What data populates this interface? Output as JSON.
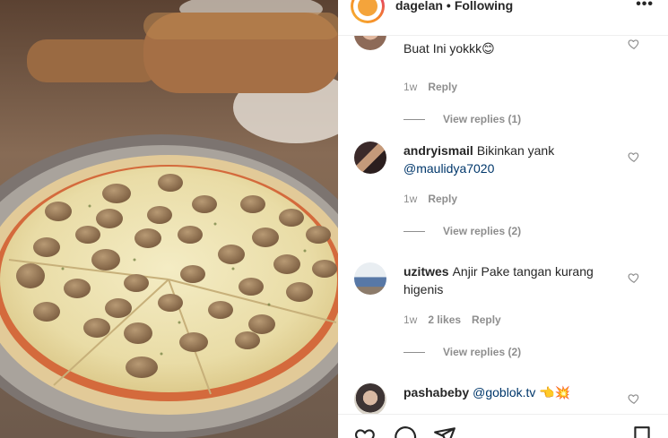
{
  "header": {
    "username": "dagelan",
    "separator": "•",
    "follow_status": "Following",
    "more_glyph": "•••"
  },
  "comments": [
    {
      "username": "",
      "text": "Buat Ini yokkk😊",
      "time": "1w",
      "likes": "",
      "reply_label": "Reply",
      "view_replies": "View replies (1)"
    },
    {
      "username": "andryismail",
      "text": "Bikinkan yank",
      "mention": "@maulidya7020",
      "time": "1w",
      "likes": "",
      "reply_label": "Reply",
      "view_replies": "View replies (2)"
    },
    {
      "username": "uzitwes",
      "text": "Anjir Pake tangan kurang higenis",
      "time": "1w",
      "likes": "2 likes",
      "reply_label": "Reply",
      "view_replies": "View replies (2)"
    },
    {
      "username": "pashabeby",
      "text": "",
      "mention": "@goblok.tv",
      "emoji": "👈💥"
    }
  ],
  "icons": {
    "like": "heart-icon",
    "comment": "comment-icon",
    "share": "paper-plane-icon",
    "save": "bookmark-icon",
    "more": "more-options-icon"
  },
  "colors": {
    "text": "#262626",
    "secondary": "#8e8e8e",
    "link": "#00376b",
    "divider": "#efefef"
  }
}
